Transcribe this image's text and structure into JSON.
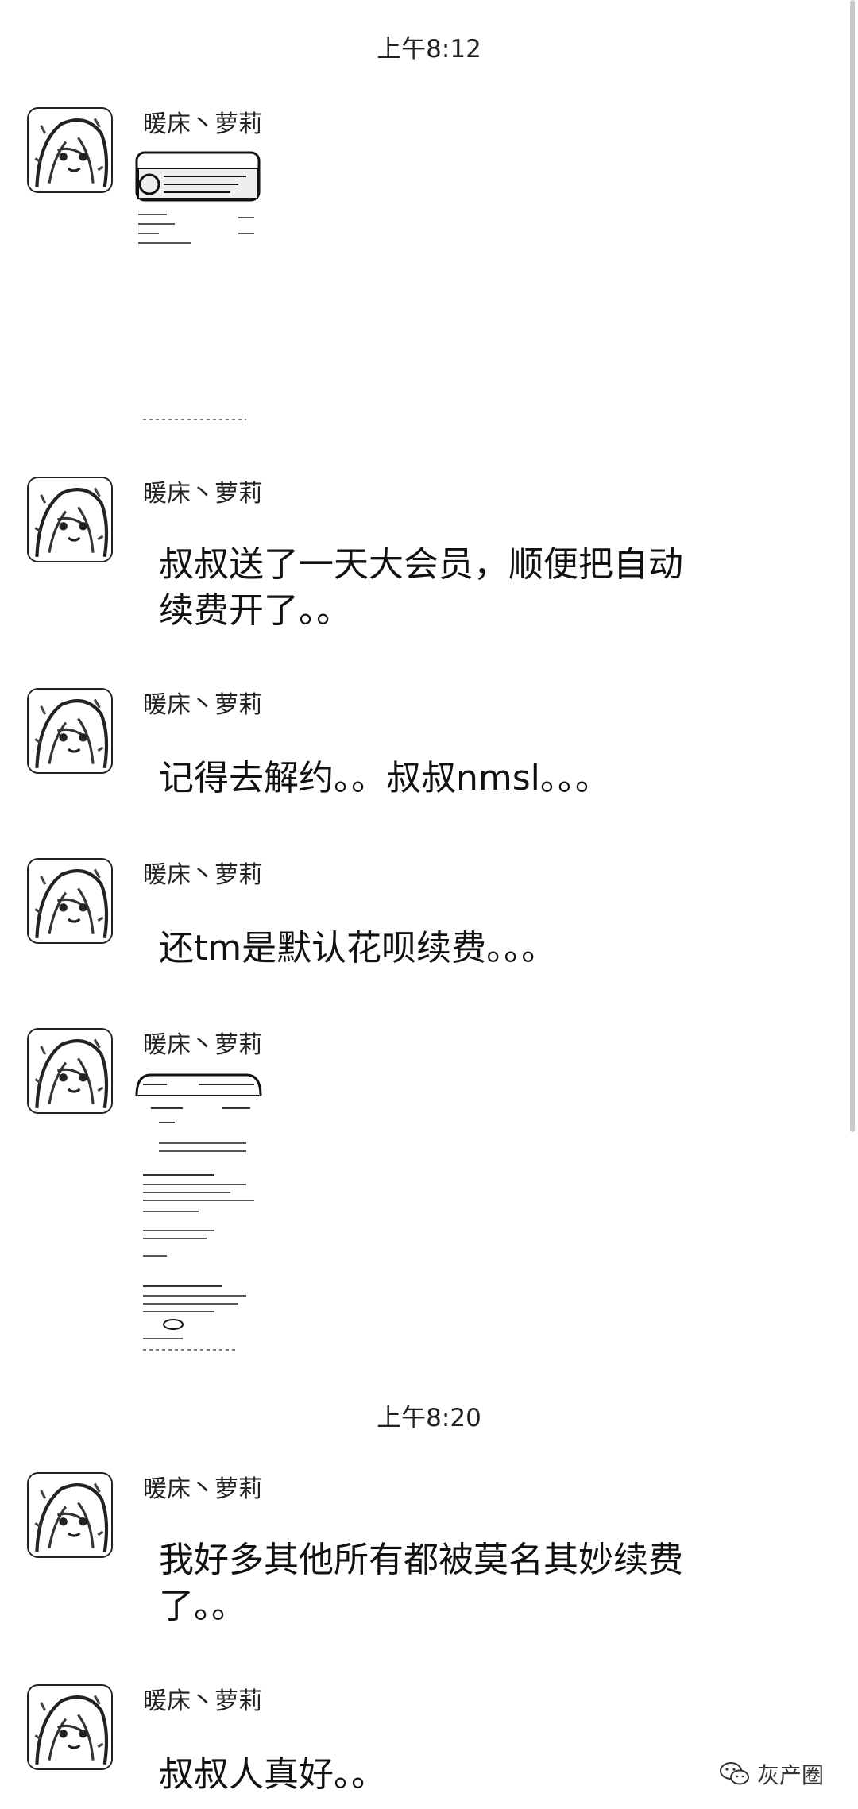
{
  "chat": {
    "timestamps": [
      "上午8:12",
      "上午8:20"
    ],
    "sender_name": "暖床丶萝莉",
    "messages": [
      {
        "type": "image"
      },
      {
        "type": "text",
        "lines": [
          "叔叔送了一天大会员，顺便把自动",
          "续费开了。。"
        ]
      },
      {
        "type": "text",
        "lines": [
          "记得去解约。。叔叔nmsl。。。"
        ]
      },
      {
        "type": "text",
        "lines": [
          "还tm是默认花呗续费。。。"
        ]
      },
      {
        "type": "image"
      },
      {
        "type": "text",
        "lines": [
          "我好多其他所有都被莫名其妙续费",
          "了。。"
        ]
      },
      {
        "type": "text",
        "lines": [
          "叔叔人真好。。"
        ]
      }
    ]
  },
  "watermark": {
    "text": "灰产圈",
    "icon": "wechat-icon"
  },
  "colors": {
    "background": "#ffffff",
    "text": "#111111",
    "scrollbar": "#c9c9c9"
  }
}
